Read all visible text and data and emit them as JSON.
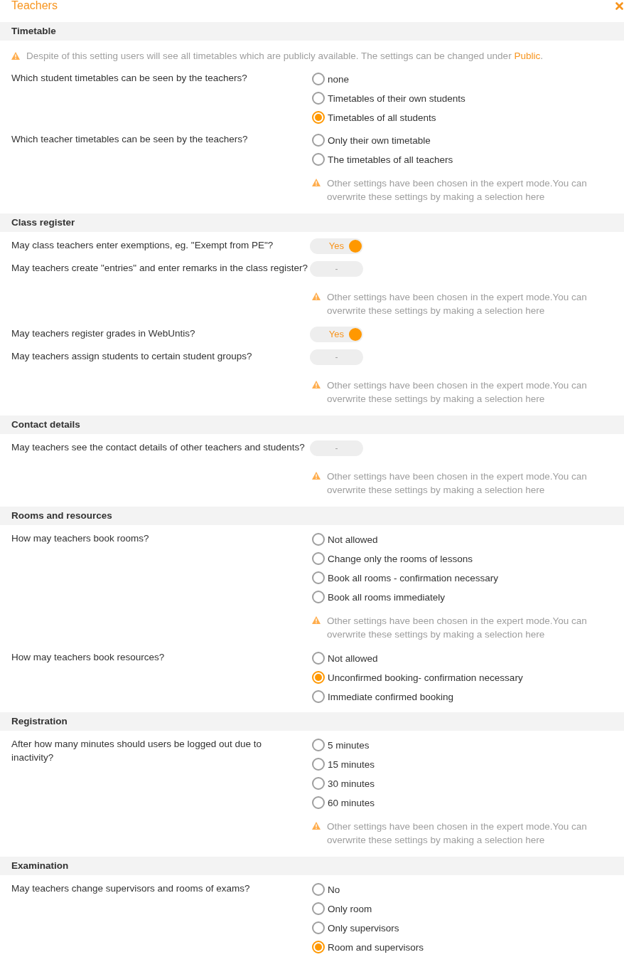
{
  "window": {
    "title": "Teachers"
  },
  "sections": [
    {
      "title": "Timetable",
      "notice": {
        "text": "Despite of this setting users will see all timetables which are publicly available. The settings can be changed under ",
        "link": "Public",
        "text_after": "."
      },
      "rows": [
        {
          "kind": "radio",
          "question": "Which student timetables can be seen by the teachers?",
          "options": [
            {
              "label": "none",
              "selected": false
            },
            {
              "label": "Timetables of their own students",
              "selected": false
            },
            {
              "label": "Timetables of all students",
              "selected": true
            }
          ]
        },
        {
          "kind": "radio",
          "question": "Which teacher timetables can be seen by the teachers?",
          "options": [
            {
              "label": "Only their own timetable",
              "selected": false
            },
            {
              "label": "The timetables of all teachers",
              "selected": false
            }
          ],
          "note": "Other settings have been chosen in the expert mode.You can overwrite these settings by making a selection here"
        }
      ]
    },
    {
      "title": "Class register",
      "rows": [
        {
          "kind": "toggle",
          "question": "May class teachers enter exemptions, eg. \"Exempt from PE\"?",
          "value": "Yes",
          "on": true
        },
        {
          "kind": "toggle",
          "question": "May teachers create \"entries\" and enter remarks in the class register?",
          "value": "-",
          "on": false,
          "note": "Other settings have been chosen in the expert mode.You can overwrite these settings by making a selection here"
        },
        {
          "kind": "toggle",
          "question": "May teachers register grades in WebUntis?",
          "value": "Yes",
          "on": true
        },
        {
          "kind": "toggle",
          "question": "May teachers assign students to certain student groups?",
          "value": "-",
          "on": false,
          "note": "Other settings have been chosen in the expert mode.You can overwrite these settings by making a selection here"
        }
      ]
    },
    {
      "title": "Contact details",
      "rows": [
        {
          "kind": "toggle",
          "question": "May teachers see the contact details of other teachers and students?",
          "value": "-",
          "on": false,
          "note": "Other settings have been chosen in the expert mode.You can overwrite these settings by making a selection here"
        }
      ]
    },
    {
      "title": "Rooms and resources",
      "rows": [
        {
          "kind": "radio",
          "question": "How may teachers book rooms?",
          "options": [
            {
              "label": "Not allowed",
              "selected": false
            },
            {
              "label": "Change only the rooms of lessons",
              "selected": false
            },
            {
              "label": "Book all rooms - confirmation necessary",
              "selected": false
            },
            {
              "label": "Book all rooms immediately",
              "selected": false
            }
          ],
          "note": "Other settings have been chosen in the expert mode.You can overwrite these settings by making a selection here"
        },
        {
          "kind": "radio",
          "question": "How may teachers book resources?",
          "options": [
            {
              "label": "Not allowed",
              "selected": false
            },
            {
              "label": "Unconfirmed booking- confirmation necessary",
              "selected": true
            },
            {
              "label": "Immediate confirmed booking",
              "selected": false
            }
          ]
        }
      ]
    },
    {
      "title": "Registration",
      "rows": [
        {
          "kind": "radio",
          "question": "After how many minutes should users be logged out due to inactivity?",
          "options": [
            {
              "label": "5 minutes",
              "selected": false
            },
            {
              "label": "15 minutes",
              "selected": false
            },
            {
              "label": "30 minutes",
              "selected": false
            },
            {
              "label": "60 minutes",
              "selected": false
            }
          ],
          "note": "Other settings have been chosen in the expert mode.You can overwrite these settings by making a selection here"
        }
      ]
    },
    {
      "title": "Examination",
      "rows": [
        {
          "kind": "radio",
          "question": "May teachers change supervisors and rooms of exams?",
          "options": [
            {
              "label": "No",
              "selected": false
            },
            {
              "label": "Only room",
              "selected": false
            },
            {
              "label": "Only supervisors",
              "selected": false
            },
            {
              "label": "Room and supervisors",
              "selected": true
            }
          ]
        }
      ]
    }
  ]
}
